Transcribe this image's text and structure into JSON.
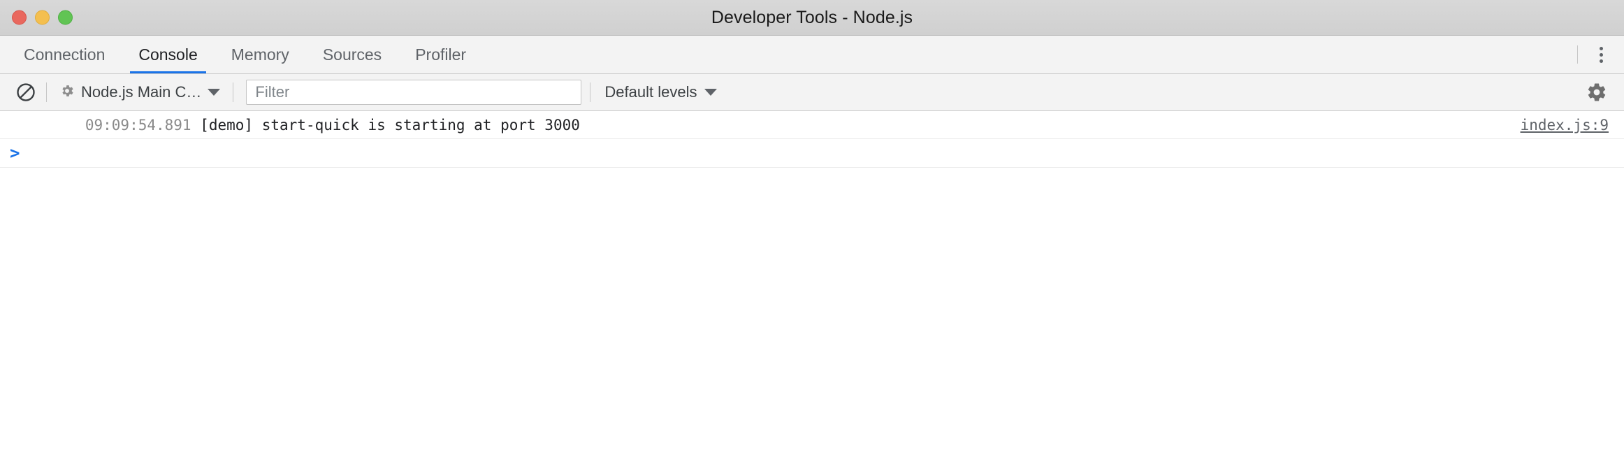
{
  "window": {
    "title": "Developer Tools - Node.js",
    "controls": [
      {
        "name": "close",
        "color": "#e9685e"
      },
      {
        "name": "minimize",
        "color": "#f4bf4f"
      },
      {
        "name": "zoom",
        "color": "#61c454"
      }
    ]
  },
  "tabs": [
    {
      "label": "Connection",
      "active": false
    },
    {
      "label": "Console",
      "active": true
    },
    {
      "label": "Memory",
      "active": false
    },
    {
      "label": "Sources",
      "active": false
    },
    {
      "label": "Profiler",
      "active": false
    }
  ],
  "tabbar": {
    "more_icon": "kebab-menu-icon"
  },
  "toolbar": {
    "clear_icon": "clear-console-icon",
    "context_icon": "gear-icon",
    "context_label": "Node.js Main C…",
    "context_caret": "▼",
    "filter_placeholder": "Filter",
    "filter_value": "",
    "levels_label": "Default levels",
    "levels_caret": "▼",
    "settings_icon": "settings-gear-icon"
  },
  "console": {
    "messages": [
      {
        "timestamp": "09:09:54.891",
        "text": " [demo] start-quick is starting at port 3000",
        "source": "index.js:9"
      }
    ],
    "prompt": ">",
    "prompt_value": ""
  },
  "colors": {
    "accent": "#1a73e8",
    "titlebar_bg": "#d4d4d4",
    "toolbar_bg": "#f3f3f3",
    "body_bg": "#ffffff",
    "text": "#202124",
    "muted_text": "#5f6368"
  }
}
